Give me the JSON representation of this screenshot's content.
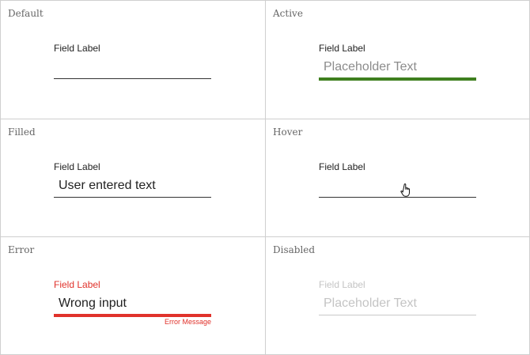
{
  "states": {
    "default": {
      "title": "Default",
      "label": "Field Label",
      "value": ""
    },
    "active": {
      "title": "Active",
      "label": "Field Label",
      "placeholder": "Placeholder Text"
    },
    "filled": {
      "title": "Filled",
      "label": "Field Label",
      "value": "User entered text"
    },
    "hover": {
      "title": "Hover",
      "label": "Field Label",
      "value": ""
    },
    "error": {
      "title": "Error",
      "label": "Field Label",
      "value": "Wrong input",
      "message": "Error Message"
    },
    "disabled": {
      "title": "Disabled",
      "label": "Field Label",
      "placeholder": "Placeholder Text"
    }
  },
  "colors": {
    "active_accent": "#3f7f1f",
    "error": "#e0322b",
    "disabled": "#c4c4c4",
    "border": "#cfcfcf"
  },
  "icons": {
    "hover_cursor": "hand-pointer-icon"
  }
}
